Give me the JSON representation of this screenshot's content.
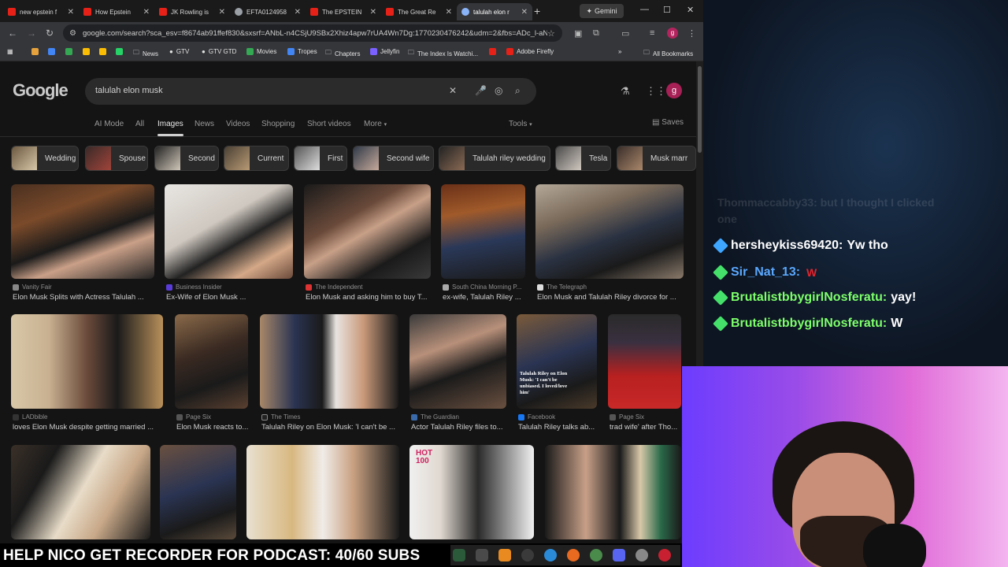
{
  "browser": {
    "tabs": [
      {
        "label": "new epstein f",
        "favicon_color": "#e62117"
      },
      {
        "label": "How Epstein",
        "favicon_color": "#e62117"
      },
      {
        "label": "JK Rowling is",
        "favicon_color": "#e62117"
      },
      {
        "label": "EFTA0124958",
        "favicon_color": "#9aa0a6"
      },
      {
        "label": "The EPSTEIN",
        "favicon_color": "#e62117"
      },
      {
        "label": "The Great Re",
        "favicon_color": "#e62117"
      },
      {
        "label": "talulah elon r",
        "favicon_color": "#8ab4f8"
      }
    ],
    "gemini_label": "Gemini",
    "url": "google.com/search?sca_esv=f8674ab91ffef830&sxsrf=ANbL-n4CSjU9SBx2Xhiz4apw7rUA4Wn7Dg:1770230476242&udm=2&fbs=ADc_l-aN...",
    "profile_letter": "g",
    "bookmarks": [
      {
        "label": "",
        "color": "#e6a23c"
      },
      {
        "label": "",
        "color": "#4285f4"
      },
      {
        "label": "",
        "color": "#34a853"
      },
      {
        "label": "",
        "color": "#fbbc04"
      },
      {
        "label": "",
        "color": "#25d366"
      },
      {
        "label": "News",
        "color": "#9aa0a6"
      },
      {
        "label": "GTV",
        "color": "#9aa0a6"
      },
      {
        "label": "GTV GTD",
        "color": "#9aa0a6"
      },
      {
        "label": "Movies",
        "color": "#34a853"
      },
      {
        "label": "Tropes",
        "color": "#4285f4"
      },
      {
        "label": "Chapters",
        "color": "#9aa0a6"
      },
      {
        "label": "Jellyfin",
        "color": "#7b61ff"
      },
      {
        "label": "The Index Is Watchi...",
        "color": "#9aa0a6"
      },
      {
        "label": "",
        "color": "#e62117"
      },
      {
        "label": "Adobe Firefly",
        "color": "#e62117"
      }
    ],
    "all_bookmarks": "All Bookmarks"
  },
  "google": {
    "logo": "Google",
    "query": "talulah elon musk",
    "nav_tabs": [
      "AI Mode",
      "All",
      "Images",
      "News",
      "Videos",
      "Shopping",
      "Short videos",
      "More"
    ],
    "tools": "Tools",
    "saves": "Saves",
    "chips": [
      "Wedding",
      "Spouse",
      "Second",
      "Current",
      "First",
      "Second wife",
      "Talulah riley wedding",
      "Tesla",
      "Musk marr"
    ],
    "results": [
      {
        "source": "Vanity Fair",
        "title": "Elon Musk Splits with Actress Talulah ..."
      },
      {
        "source": "Business Insider",
        "title": "Ex-Wife of Elon Musk ..."
      },
      {
        "source": "The Independent",
        "title": "Elon Musk and asking him to buy T..."
      },
      {
        "source": "South China Morning P...",
        "title": "ex-wife, Talulah Riley ..."
      },
      {
        "source": "The Telegraph",
        "title": "Elon Musk and Talulah Riley divorce for ..."
      },
      {
        "source": "LADbible",
        "title": "loves Elon Musk despite getting married ..."
      },
      {
        "source": "Page Six",
        "title": "Elon Musk reacts to..."
      },
      {
        "source": "The Times",
        "title": "Talulah Riley on Elon Musk: 'I can't be ..."
      },
      {
        "source": "The Guardian",
        "title": "Actor Talulah Riley files to..."
      },
      {
        "source": "Facebook",
        "title": "Talulah Riley talks ab..."
      },
      {
        "source": "Page Six",
        "title": "trad wife' after Tho..."
      },
      {
        "source": "",
        "title": ""
      },
      {
        "source": "",
        "title": ""
      },
      {
        "source": "",
        "title": ""
      },
      {
        "source": "",
        "title": ""
      },
      {
        "source": "",
        "title": ""
      }
    ],
    "overlay_text": "Talulah Riley on Elon Musk: 'I can't be unbiased. I loved/love him'",
    "hot_text": "HOT 100"
  },
  "chat": {
    "ghost": "Thommaccabby33: but I thought I clicked one",
    "messages": [
      {
        "user": "hersheykiss69420",
        "text": "Yw tho",
        "user_color": "#ffffff",
        "badge_color": "#3ea6ff"
      },
      {
        "user": "Sir_Nat_13",
        "text": "",
        "emote": "W",
        "user_color": "#5aa8ff",
        "badge_color": "#45e06a"
      },
      {
        "user": "BrutalistbbygirlNosferatu",
        "text": "yay!",
        "user_color": "#7dff6a",
        "badge_color": "#45e06a"
      },
      {
        "user": "BrutalistbbygirlNosferatu",
        "text": "W",
        "user_color": "#7dff6a",
        "badge_color": "#45e06a"
      }
    ]
  },
  "banner": {
    "text": "HELP NICO GET RECORDER FOR PODCAST: 40/60 SUBS"
  }
}
